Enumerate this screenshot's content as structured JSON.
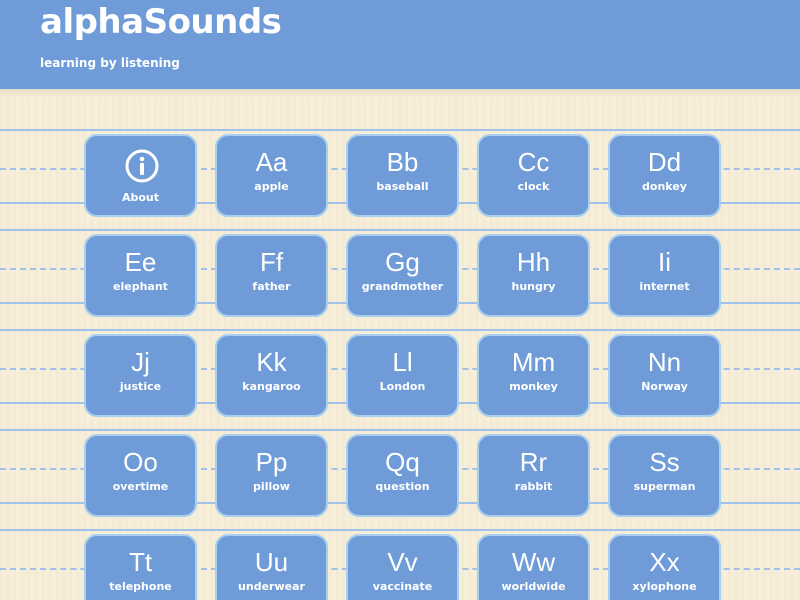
{
  "header": {
    "title": "alphaSounds",
    "subtitle": "learning by listening"
  },
  "about": {
    "label": "About",
    "icon": "info-icon"
  },
  "tiles": [
    {
      "letters": "Aa",
      "word": "apple"
    },
    {
      "letters": "Bb",
      "word": "baseball"
    },
    {
      "letters": "Cc",
      "word": "clock"
    },
    {
      "letters": "Dd",
      "word": "donkey"
    },
    {
      "letters": "Ee",
      "word": "elephant"
    },
    {
      "letters": "Ff",
      "word": "father"
    },
    {
      "letters": "Gg",
      "word": "grandmother"
    },
    {
      "letters": "Hh",
      "word": "hungry"
    },
    {
      "letters": "Ii",
      "word": "internet"
    },
    {
      "letters": "Jj",
      "word": "justice"
    },
    {
      "letters": "Kk",
      "word": "kangaroo"
    },
    {
      "letters": "Ll",
      "word": "London"
    },
    {
      "letters": "Mm",
      "word": "monkey"
    },
    {
      "letters": "Nn",
      "word": "Norway"
    },
    {
      "letters": "Oo",
      "word": "overtime"
    },
    {
      "letters": "Pp",
      "word": "pillow"
    },
    {
      "letters": "Qq",
      "word": "question"
    },
    {
      "letters": "Rr",
      "word": "rabbit"
    },
    {
      "letters": "Ss",
      "word": "superman"
    },
    {
      "letters": "Tt",
      "word": "telephone"
    },
    {
      "letters": "Uu",
      "word": "underwear"
    },
    {
      "letters": "Vv",
      "word": "vaccinate"
    },
    {
      "letters": "Ww",
      "word": "worldwide"
    },
    {
      "letters": "Xx",
      "word": "xylophone"
    }
  ],
  "colors": {
    "header_bg": "#6f9cd8",
    "tile_bg": "#6f9cd8",
    "tile_border": "#a9cfee",
    "paper_bg": "#f6eed9",
    "rule_line": "#9fc1ea"
  }
}
